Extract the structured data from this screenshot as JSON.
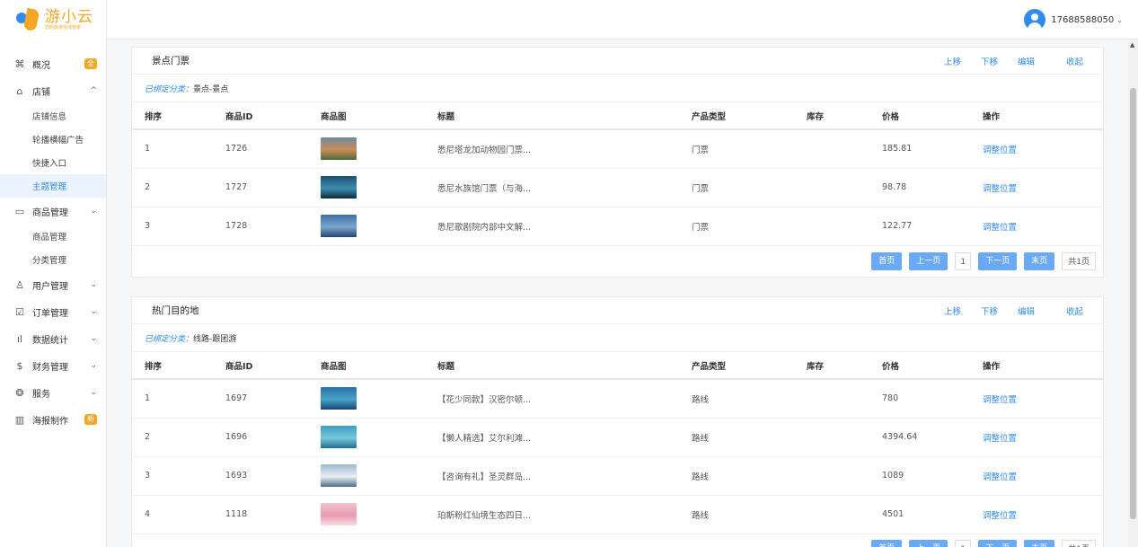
{
  "brand": {
    "title": "游小云",
    "subtitle": "您的旅游在线管家"
  },
  "user": {
    "phone": "17688588050"
  },
  "sidebar": {
    "items": [
      {
        "icon": "command-icon",
        "glyph": "⌘",
        "label": "概况",
        "badge": "全"
      },
      {
        "icon": "store-icon",
        "glyph": "⌂",
        "label": "店铺",
        "arrow": "^"
      },
      {
        "sub": true,
        "label": "店铺信息"
      },
      {
        "sub": true,
        "label": "轮播横幅广告"
      },
      {
        "sub": true,
        "label": "快捷入口"
      },
      {
        "sub": true,
        "label": "主题管理",
        "active": true
      },
      {
        "icon": "calendar-icon",
        "glyph": "▭",
        "label": "商品管理",
        "arrow": "⌄"
      },
      {
        "sub": true,
        "label": "商品管理"
      },
      {
        "sub": true,
        "label": "分类管理"
      },
      {
        "icon": "users-icon",
        "glyph": "♙",
        "label": "用户管理",
        "arrow": "⌄"
      },
      {
        "icon": "order-icon",
        "glyph": "☑",
        "label": "订单管理",
        "arrow": "⌄"
      },
      {
        "icon": "stats-icon",
        "glyph": "ıl",
        "label": "数据统计",
        "arrow": "⌄"
      },
      {
        "icon": "finance-icon",
        "glyph": "$",
        "label": "财务管理",
        "arrow": "⌄"
      },
      {
        "icon": "service-icon",
        "glyph": "❂",
        "label": "服务",
        "arrow": "⌄"
      },
      {
        "icon": "map-icon",
        "glyph": "▥",
        "label": "海报制作",
        "badge": "新"
      }
    ]
  },
  "panel_actions": {
    "up": "上移",
    "down": "下移",
    "edit": "编辑",
    "collapse": "收起"
  },
  "table_headers": [
    "排序",
    "商品ID",
    "商品图",
    "标题",
    "产品类型",
    "库存",
    "价格",
    "操作"
  ],
  "pager": {
    "first": "首页",
    "prev": "上一页",
    "page": "1",
    "next": "下一页",
    "last": "末页",
    "total": "共1页"
  },
  "panels": [
    {
      "title": "景点门票",
      "bound_label": "已绑定分类：",
      "bound_value": "景点-景点",
      "rows": [
        {
          "order": "1",
          "id": "1726",
          "title": "悉尼塔龙加动物园门票...",
          "type": "门票",
          "stock": "",
          "price": "185.81",
          "op": "调整位置",
          "img": [
            "#6e8aa0",
            "#c98e55",
            "#4a6a3a"
          ]
        },
        {
          "order": "2",
          "id": "1727",
          "title": "悉尼水族馆门票（与海...",
          "type": "门票",
          "stock": "",
          "price": "98.78",
          "op": "调整位置",
          "img": [
            "#1d4f6e",
            "#3a8fb0",
            "#0e2a3a"
          ]
        },
        {
          "order": "3",
          "id": "1728",
          "title": "悉尼歌剧院内部中文解...",
          "type": "门票",
          "stock": "",
          "price": "122.77",
          "op": "调整位置",
          "img": [
            "#3d6fa8",
            "#7aa6cf",
            "#23456e"
          ]
        }
      ]
    },
    {
      "title": "热门目的地",
      "bound_label": "已绑定分类：",
      "bound_value": "线路-跟团游",
      "rows": [
        {
          "order": "1",
          "id": "1697",
          "title": "【花少同款】汉密尔顿...",
          "type": "路线",
          "stock": "",
          "price": "780",
          "op": "调整位置",
          "img": [
            "#2b6ea8",
            "#46a5c9",
            "#1d4470"
          ]
        },
        {
          "order": "2",
          "id": "1696",
          "title": "【懒人精选】艾尔利滩...",
          "type": "路线",
          "stock": "",
          "price": "4394.64",
          "op": "调整位置",
          "img": [
            "#3f9ec2",
            "#76c7d9",
            "#1f6f8f"
          ]
        },
        {
          "order": "3",
          "id": "1693",
          "title": "【咨询有礼】圣灵群岛...",
          "type": "路线",
          "stock": "",
          "price": "1089",
          "op": "调整位置",
          "img": [
            "#9fb8cf",
            "#e8eef3",
            "#4d6d8a"
          ]
        },
        {
          "order": "4",
          "id": "1118",
          "title": "珀斯粉红仙境生态四日...",
          "type": "路线",
          "stock": "",
          "price": "4501",
          "op": "调整位置",
          "img": [
            "#f3c3cf",
            "#e89aae",
            "#f8dde4"
          ]
        }
      ]
    }
  ]
}
